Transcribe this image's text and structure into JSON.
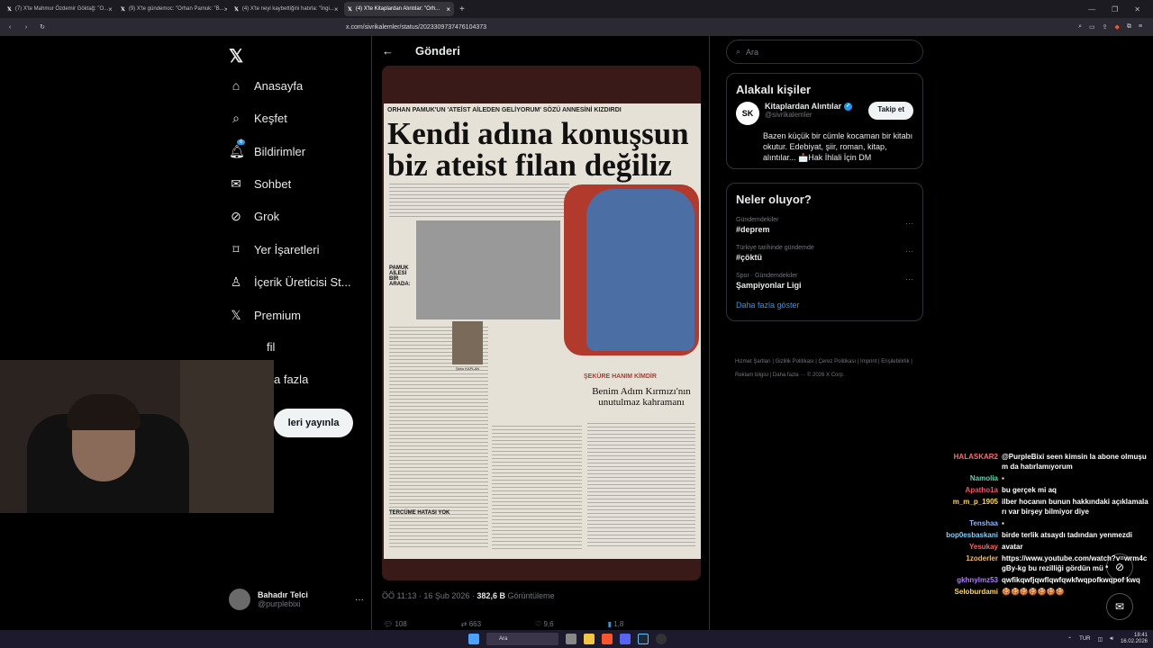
{
  "browser": {
    "tabs": [
      {
        "label": "(7) X'te Mahmur Özdemir Göktağ: \"O...",
        "active": false
      },
      {
        "label": "(9) X'te gündemoc: \"Orhan Pamuk: \"B...",
        "active": false
      },
      {
        "label": "(4) X'te neyi kaybettiğini hatırla: \"İngi...",
        "active": false
      },
      {
        "label": "(4) X'te Kitaplardan Alıntılar: \"Orh...",
        "active": true
      }
    ],
    "url": "x.com/sivrikalemler/status/2023309737476104373"
  },
  "sidebar": {
    "items": [
      {
        "label": "Anasayfa",
        "icon": "home-icon"
      },
      {
        "label": "Keşfet",
        "icon": "search-icon"
      },
      {
        "label": "Bildirimler",
        "icon": "bell-icon",
        "badge": "6"
      },
      {
        "label": "Sohbet",
        "icon": "mail-icon"
      },
      {
        "label": "Grok",
        "icon": "grok-icon"
      },
      {
        "label": "Yer İşaretleri",
        "icon": "bookmark-icon"
      },
      {
        "label": "İçerik Üreticisi St...",
        "icon": "creator-icon"
      },
      {
        "label": "Premium",
        "icon": "x-icon"
      },
      {
        "label": "fil",
        "icon": "profile-icon"
      },
      {
        "label": "a fazla",
        "icon": "more-icon"
      }
    ],
    "post_button": "leri yayınla",
    "user": {
      "name": "Bahadır Telci",
      "handle": "@purplebixi"
    }
  },
  "post": {
    "header": "Gönderi",
    "image": {
      "kicker": "ORHAN PAMUK'UN 'ATEİST AİLEDEN GELİYORUM' SÖZÜ ANNESİNİ KIZDIRDI",
      "headline": "Kendi adına konuşsun biz ateist filan değiliz",
      "caption": "ŞEKÜRE HANIM KİMDİR",
      "subhead": "Benim Adım Kırmızı'nın unutulmaz kahramanı",
      "sidebar_label": "PAMUK AİLESİ BİR ARADA:",
      "inset_caption": "Şeko KAPLAN",
      "section": "TERCÜME HATASI YOK"
    },
    "meta_time": "ÖÖ 11:13 · 16 Şub 2026 ·",
    "meta_views": "382,6 B",
    "meta_views_label": "Görüntüleme",
    "actions": [
      "108",
      "663",
      "9,6",
      "1,8"
    ]
  },
  "right": {
    "search_placeholder": "Ara",
    "related_title": "Alakalı kişiler",
    "related": {
      "logo": "SK",
      "name": "Kitaplardan Alıntılar",
      "handle": "@sivrikalemler",
      "follow": "Takip et",
      "bio": "Bazen küçük bir cümle kocaman bir kitabı okutur. Edebiyat, şiir, roman, kitap, alıntılar... 📩Hak İhlali İçin DM"
    },
    "trends_title": "Neler oluyor?",
    "trends": [
      {
        "category": "Gündemdekiler",
        "title": "#deprem"
      },
      {
        "category": "Türkiye tarihinde gündemde",
        "title": "#çöktü"
      },
      {
        "category": "Spor · Gündemdekiler",
        "title": "Şampiyonlar Ligi"
      }
    ],
    "show_more": "Daha fazla göster",
    "footer": "Hizmet Şartları  |  Gizlilik Politikası  |  Çerez Politikası  |  Imprint  |  Erişilebilirlik  |  Reklam bilgisi  |  Daha fazla ···  © 2026 X Corp."
  },
  "chat": [
    {
      "user": "HALASKAR2",
      "color": "#ff6b6b",
      "text": "@PurpleBixi seen kimsin la abone olmuşum da hatırlamıyorum"
    },
    {
      "user": "Namolia",
      "color": "#5ad4b0",
      "text": "▪"
    },
    {
      "user": "Apatho1a",
      "color": "#ff4f6b",
      "text": "bu gerçek mi aq"
    },
    {
      "user": "m_m_p_1905",
      "color": "#ffd84d",
      "text": "ilber hocanın bunun hakkındaki açıklamaları var birşey bilmiyor diye"
    },
    {
      "user": "Tenshaa",
      "color": "#8ab4ff",
      "text": "▪"
    },
    {
      "user": "bop0esbaskani",
      "color": "#7fd0ff",
      "text": "birde terlik atsaydı tadından yenmezdi"
    },
    {
      "user": "Yesukay",
      "color": "#ff6060",
      "text": "avatar"
    },
    {
      "user": "1zoderler",
      "color": "#ffb84d",
      "text": "https://www.youtube.com/watch?v=wrm4cgBy-kg bu rezilliği gördün mü *"
    },
    {
      "user": "gkhnylmz53",
      "color": "#b07cff",
      "text": "qwfikqwfjqwflqwfqwkfwqpofkwqpof kwq"
    },
    {
      "user": "Seloburdami",
      "color": "#ffd84d",
      "text": "🍪🍪🍪🍪🍪🍪🍪"
    }
  ],
  "taskbar": {
    "search": "Ara",
    "lang": "TUR",
    "time": "18:41",
    "date": "16.02.2026"
  },
  "colors": {
    "accent": "#1d9bf0",
    "background": "#000000"
  }
}
